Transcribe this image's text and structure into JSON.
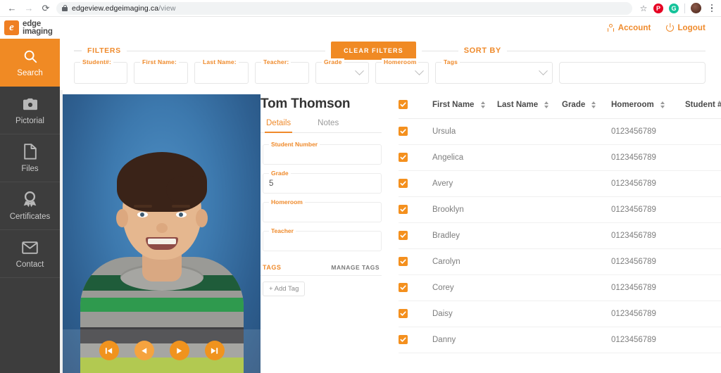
{
  "browser": {
    "back_icon": "arrow-left-icon",
    "forward_icon": "arrow-right-icon",
    "reload_icon": "reload-icon",
    "lock_icon": "lock-icon",
    "url_domain": "edgeview.edgeimaging.ca",
    "url_path": "/view",
    "star_icon": "☆",
    "extensions": [
      {
        "name": "pinterest-extension",
        "glyph": "P",
        "color": "#e60023"
      },
      {
        "name": "grammarly-extension",
        "glyph": "G",
        "color": "#15c39a"
      }
    ],
    "profile_icon": "profile-avatar",
    "menu_icon": "kebab-menu-icon"
  },
  "header": {
    "logo_mark": "e",
    "logo_line1": "edge",
    "logo_line2": "imaging",
    "account_label": "Account",
    "logout_label": "Logout",
    "account_icon": "person-icon",
    "logout_icon": "power-icon"
  },
  "sidebar": {
    "items": [
      {
        "label": "Search",
        "icon": "search-icon",
        "active": true
      },
      {
        "label": "Pictorial",
        "icon": "camera-icon",
        "active": false
      },
      {
        "label": "Files",
        "icon": "file-icon",
        "active": false
      },
      {
        "label": "Certificates",
        "icon": "award-icon",
        "active": false
      },
      {
        "label": "Contact",
        "icon": "envelope-icon",
        "active": false
      }
    ]
  },
  "filters": {
    "section_label": "FILTERS",
    "clear_button": "CLEAR FILTERS",
    "sort_by_label": "SORT BY",
    "sort_by_value": "",
    "sort_by_placeholder": "",
    "fields": [
      {
        "label": "Student#:",
        "value": "",
        "type": "text",
        "name": "filter-student-number"
      },
      {
        "label": "First Name:",
        "value": "",
        "type": "text",
        "name": "filter-first-name"
      },
      {
        "label": "Last Name:",
        "value": "",
        "type": "text",
        "name": "filter-last-name"
      },
      {
        "label": "Teacher:",
        "value": "",
        "type": "text",
        "name": "filter-teacher"
      },
      {
        "label": "Grade",
        "value": "",
        "type": "select",
        "name": "filter-grade"
      },
      {
        "label": "Homeroom",
        "value": "",
        "type": "select",
        "name": "filter-homeroom"
      },
      {
        "label": "Tags",
        "value": "",
        "type": "select",
        "name": "filter-tags"
      }
    ]
  },
  "photo": {
    "alt": "student-portrait",
    "nav": [
      {
        "name": "first-photo-button",
        "icon": "skip-back-icon"
      },
      {
        "name": "previous-photo-button",
        "icon": "previous-icon"
      },
      {
        "name": "next-photo-button",
        "icon": "play-icon"
      },
      {
        "name": "last-photo-button",
        "icon": "skip-forward-icon"
      }
    ]
  },
  "details": {
    "student_name": "Tom Thomson",
    "tabs": [
      {
        "label": "Details",
        "active": true
      },
      {
        "label": "Notes",
        "active": false
      }
    ],
    "fields": [
      {
        "label": "Student Number",
        "value": ""
      },
      {
        "label": "Grade",
        "value": "5"
      },
      {
        "label": "Homeroom",
        "value": ""
      },
      {
        "label": "Teacher",
        "value": ""
      }
    ],
    "tags_label": "TAGS",
    "manage_tags_label": "MANAGE TAGS",
    "add_tag_label": "+ Add Tag"
  },
  "table": {
    "select_all_checked": true,
    "columns": [
      {
        "key": "checkbox",
        "label": "",
        "sortable": false
      },
      {
        "key": "first_name",
        "label": "First Name",
        "sortable": true
      },
      {
        "key": "last_name",
        "label": "Last Name",
        "sortable": true
      },
      {
        "key": "grade",
        "label": "Grade",
        "sortable": true
      },
      {
        "key": "homeroom",
        "label": "Homeroom",
        "sortable": true
      },
      {
        "key": "student_number",
        "label": "Student #",
        "sortable": true
      }
    ],
    "rows": [
      {
        "checked": true,
        "first_name": "Ursula",
        "last_name": "",
        "grade": "",
        "homeroom": "0123456789",
        "student_number": ""
      },
      {
        "checked": true,
        "first_name": "Angelica",
        "last_name": "",
        "grade": "",
        "homeroom": "0123456789",
        "student_number": ""
      },
      {
        "checked": true,
        "first_name": "Avery",
        "last_name": "",
        "grade": "",
        "homeroom": "0123456789",
        "student_number": ""
      },
      {
        "checked": true,
        "first_name": "Brooklyn",
        "last_name": "",
        "grade": "",
        "homeroom": "0123456789",
        "student_number": ""
      },
      {
        "checked": true,
        "first_name": "Bradley",
        "last_name": "",
        "grade": "",
        "homeroom": "0123456789",
        "student_number": ""
      },
      {
        "checked": true,
        "first_name": "Carolyn",
        "last_name": "",
        "grade": "",
        "homeroom": "0123456789",
        "student_number": ""
      },
      {
        "checked": true,
        "first_name": "Corey",
        "last_name": "",
        "grade": "",
        "homeroom": "0123456789",
        "student_number": ""
      },
      {
        "checked": true,
        "first_name": "Daisy",
        "last_name": "",
        "grade": "",
        "homeroom": "0123456789",
        "student_number": ""
      },
      {
        "checked": true,
        "first_name": "Danny",
        "last_name": "",
        "grade": "",
        "homeroom": "0123456789",
        "student_number": ""
      }
    ]
  },
  "colors": {
    "brand_orange": "#f08a24",
    "label_orange": "#ef8a2b",
    "sidebar_dark": "#3d3d3d",
    "text_gray": "#7d7d7d"
  }
}
